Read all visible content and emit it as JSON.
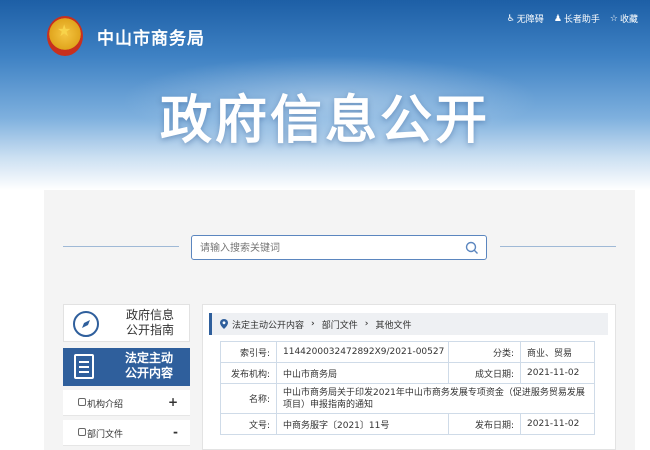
{
  "header": {
    "site_name": "中山市商务局",
    "links": [
      {
        "icon": "accessibility-icon",
        "label": "无障碍"
      },
      {
        "icon": "elder-icon",
        "label": "长者助手"
      },
      {
        "icon": "star-icon",
        "label": "收藏"
      }
    ],
    "hero_title": "政府信息公开"
  },
  "search": {
    "placeholder": "请输入搜索关键词"
  },
  "sidebar": {
    "nav": [
      {
        "label_line1": "政府信息",
        "label_line2": "公开指南",
        "active": false
      },
      {
        "label_line1": "法定主动",
        "label_line2": "公开内容",
        "active": true
      }
    ],
    "items": [
      {
        "label": "机构介绍",
        "sign": "+"
      },
      {
        "label": "部门文件",
        "sign": "-"
      }
    ]
  },
  "breadcrumb": [
    "法定主动公开内容",
    "部门文件",
    "其他文件"
  ],
  "info": {
    "index_key": "索引号:",
    "index_value": "1144200032472892X9/2021-00527",
    "category_key": "分类:",
    "category_value": "商业、贸易",
    "publisher_key": "发布机构:",
    "publisher_value": "中山市商务局",
    "created_key": "成文日期:",
    "created_value": "2021-11-02",
    "name_key": "名称:",
    "name_value": "中山市商务局关于印发2021年中山市商务发展专项资金（促进服务贸易发展项目）申报指南的通知",
    "docno_key": "文号:",
    "docno_value": "中商务服字〔2021〕11号",
    "pubdate_key": "发布日期:",
    "pubdate_value": "2021-11-02"
  },
  "colors": {
    "primary": "#2f5f9c",
    "banner_top": "#1d5fa6"
  }
}
